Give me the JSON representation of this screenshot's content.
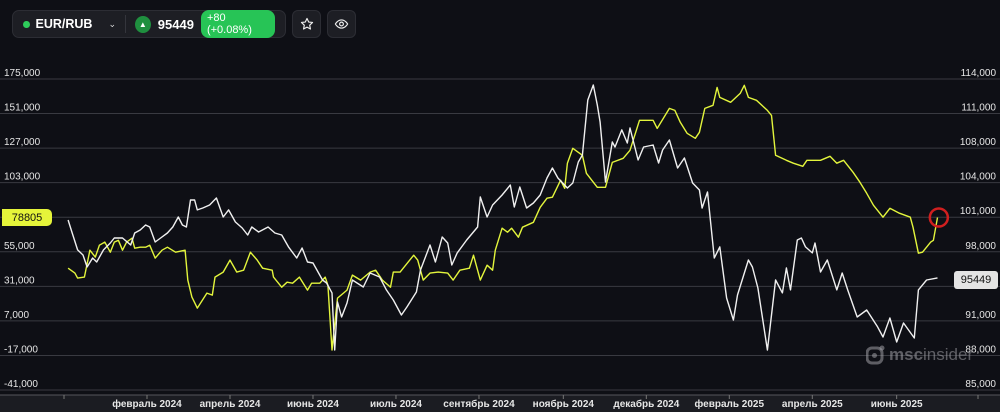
{
  "toolbar": {
    "pair": "EUR/RUB",
    "price": "95449",
    "change": "+80 (+0.08%)",
    "status_color": "#2ecc5b",
    "icons": [
      "chevron-down-icon",
      "arrow-up-icon",
      "star-icon",
      "eye-icon"
    ]
  },
  "watermark": {
    "brand_bold": "msc",
    "brand_light": "insider"
  },
  "chart_data": {
    "type": "line",
    "x_unit": "days from start",
    "x_ticks": [
      {
        "d": 61,
        "label": "февраль 2024"
      },
      {
        "d": 122,
        "label": "апрель 2024"
      },
      {
        "d": 183,
        "label": "июнь 2024"
      },
      {
        "d": 244,
        "label": "июль 2024"
      },
      {
        "d": 305,
        "label": "сентябрь 2024"
      },
      {
        "d": 367,
        "label": "ноябрь 2024"
      },
      {
        "d": 428,
        "label": "декабрь 2024"
      },
      {
        "d": 489,
        "label": "февраль 2025"
      },
      {
        "d": 550,
        "label": "апрель 2025"
      },
      {
        "d": 612,
        "label": "июнь 2025"
      }
    ],
    "left_axis": {
      "ylim": [
        -41000,
        175000
      ],
      "ticks": [
        "175,000",
        "151,000",
        "127,000",
        "103,000",
        "55,000",
        "31,000",
        "7,000",
        "-17,000",
        "-41,000"
      ],
      "tick_values": [
        175000,
        151000,
        127000,
        103000,
        55000,
        31000,
        7000,
        -17000,
        -41000
      ]
    },
    "right_axis": {
      "ylim": [
        85000,
        114000
      ],
      "ticks": [
        "114,000",
        "111,000",
        "108,000",
        "104,000",
        "101,000",
        "98,000",
        "91,000",
        "88,000",
        "85,000"
      ],
      "tick_values": [
        114000,
        111000,
        108000,
        104000,
        101000,
        98000,
        91000,
        88000,
        85000
      ]
    },
    "series": [
      {
        "name": "yellow",
        "axis": "left",
        "color": "#e3f53c",
        "last_label": "78805",
        "points": [
          [
            3,
            43600
          ],
          [
            8,
            40200
          ],
          [
            10,
            36700
          ],
          [
            15,
            37400
          ],
          [
            19,
            56100
          ],
          [
            23,
            51300
          ],
          [
            26,
            59600
          ],
          [
            30,
            61700
          ],
          [
            34,
            54700
          ],
          [
            37,
            61700
          ],
          [
            40,
            63000
          ],
          [
            43,
            56100
          ],
          [
            46,
            61700
          ],
          [
            50,
            64400
          ],
          [
            52,
            57500
          ],
          [
            56,
            58200
          ],
          [
            60,
            58200
          ],
          [
            63,
            59600
          ],
          [
            67,
            50600
          ],
          [
            72,
            56100
          ],
          [
            76,
            58200
          ],
          [
            82,
            54700
          ],
          [
            89,
            56100
          ],
          [
            91,
            35300
          ],
          [
            94,
            23500
          ],
          [
            98,
            15900
          ],
          [
            105,
            26300
          ],
          [
            109,
            24900
          ],
          [
            111,
            37400
          ],
          [
            117,
            40900
          ],
          [
            122,
            49200
          ],
          [
            127,
            40900
          ],
          [
            132,
            42200
          ],
          [
            137,
            54700
          ],
          [
            142,
            49200
          ],
          [
            146,
            43600
          ],
          [
            153,
            42200
          ],
          [
            154,
            37400
          ],
          [
            160,
            30400
          ],
          [
            164,
            33900
          ],
          [
            168,
            33200
          ],
          [
            173,
            37400
          ],
          [
            179,
            28400
          ],
          [
            182,
            33200
          ],
          [
            188,
            33200
          ],
          [
            192,
            37400
          ],
          [
            194,
            31800
          ],
          [
            197,
            -13200
          ],
          [
            201,
            22800
          ],
          [
            208,
            28400
          ],
          [
            212,
            38800
          ],
          [
            218,
            35300
          ],
          [
            225,
            40900
          ],
          [
            229,
            42200
          ],
          [
            234,
            35300
          ],
          [
            240,
            30400
          ],
          [
            242,
            40900
          ],
          [
            247,
            40900
          ],
          [
            257,
            52600
          ],
          [
            260,
            49200
          ],
          [
            264,
            35300
          ],
          [
            269,
            40200
          ],
          [
            275,
            40900
          ],
          [
            282,
            40200
          ],
          [
            286,
            35300
          ],
          [
            291,
            42200
          ],
          [
            298,
            43600
          ],
          [
            301,
            52600
          ],
          [
            304,
            42200
          ],
          [
            306,
            35300
          ],
          [
            311,
            45700
          ],
          [
            315,
            42200
          ],
          [
            317,
            56100
          ],
          [
            322,
            71400
          ],
          [
            326,
            68600
          ],
          [
            329,
            71400
          ],
          [
            334,
            65100
          ],
          [
            337,
            72100
          ],
          [
            345,
            75500
          ],
          [
            350,
            85900
          ],
          [
            355,
            92200
          ],
          [
            359,
            92900
          ],
          [
            365,
            104700
          ],
          [
            368,
            99100
          ],
          [
            370,
            116500
          ],
          [
            374,
            126900
          ],
          [
            381,
            122000
          ],
          [
            384,
            109500
          ],
          [
            392,
            99800
          ],
          [
            398,
            99800
          ],
          [
            403,
            117100
          ],
          [
            411,
            119900
          ],
          [
            416,
            125500
          ],
          [
            423,
            146300
          ],
          [
            433,
            146300
          ],
          [
            436,
            140700
          ],
          [
            445,
            154600
          ],
          [
            449,
            153200
          ],
          [
            453,
            144900
          ],
          [
            458,
            137300
          ],
          [
            464,
            133800
          ],
          [
            467,
            138000
          ],
          [
            471,
            154600
          ],
          [
            477,
            156700
          ],
          [
            480,
            169200
          ],
          [
            482,
            162200
          ],
          [
            490,
            158800
          ],
          [
            497,
            165000
          ],
          [
            500,
            170600
          ],
          [
            503,
            162200
          ],
          [
            509,
            160200
          ],
          [
            517,
            153200
          ],
          [
            520,
            149700
          ],
          [
            523,
            122000
          ],
          [
            531,
            118500
          ],
          [
            536,
            116500
          ],
          [
            543,
            114400
          ],
          [
            546,
            118500
          ],
          [
            556,
            118500
          ],
          [
            563,
            121300
          ],
          [
            568,
            116500
          ],
          [
            573,
            118500
          ],
          [
            580,
            110200
          ],
          [
            585,
            103300
          ],
          [
            590,
            95600
          ],
          [
            595,
            87300
          ],
          [
            602,
            79000
          ],
          [
            607,
            85200
          ],
          [
            614,
            81800
          ],
          [
            622,
            79000
          ],
          [
            624,
            72100
          ],
          [
            628,
            54000
          ],
          [
            631,
            54700
          ],
          [
            637,
            61700
          ],
          [
            639,
            63000
          ],
          [
            642,
            78805
          ]
        ]
      },
      {
        "name": "white",
        "axis": "right",
        "color": "#f0f0f0",
        "last_label": "95449",
        "points": [
          [
            3,
            100850
          ],
          [
            6,
            99640
          ],
          [
            10,
            98060
          ],
          [
            14,
            97590
          ],
          [
            17,
            96470
          ],
          [
            21,
            97310
          ],
          [
            24,
            96940
          ],
          [
            29,
            98060
          ],
          [
            34,
            98710
          ],
          [
            37,
            99170
          ],
          [
            43,
            99170
          ],
          [
            49,
            98520
          ],
          [
            52,
            99640
          ],
          [
            56,
            99920
          ],
          [
            60,
            100390
          ],
          [
            63,
            100200
          ],
          [
            67,
            98800
          ],
          [
            71,
            99170
          ],
          [
            76,
            99640
          ],
          [
            80,
            100200
          ],
          [
            84,
            101130
          ],
          [
            87,
            100390
          ],
          [
            90,
            100200
          ],
          [
            93,
            102720
          ],
          [
            96,
            102720
          ],
          [
            98,
            101790
          ],
          [
            102,
            101970
          ],
          [
            107,
            102250
          ],
          [
            112,
            102900
          ],
          [
            117,
            101130
          ],
          [
            121,
            101790
          ],
          [
            126,
            100670
          ],
          [
            131,
            100110
          ],
          [
            135,
            99450
          ],
          [
            138,
            100200
          ],
          [
            143,
            99730
          ],
          [
            150,
            100200
          ],
          [
            155,
            99640
          ],
          [
            160,
            99450
          ],
          [
            165,
            98340
          ],
          [
            171,
            97310
          ],
          [
            175,
            98240
          ],
          [
            179,
            96940
          ],
          [
            183,
            96840
          ],
          [
            190,
            95260
          ],
          [
            193,
            94980
          ],
          [
            197,
            94050
          ],
          [
            199,
            88730
          ],
          [
            201,
            93210
          ],
          [
            204,
            91810
          ],
          [
            208,
            93110
          ],
          [
            212,
            95260
          ],
          [
            220,
            94600
          ],
          [
            225,
            95910
          ],
          [
            232,
            95540
          ],
          [
            237,
            94330
          ],
          [
            242,
            93390
          ],
          [
            248,
            91990
          ],
          [
            252,
            92740
          ],
          [
            259,
            94140
          ],
          [
            262,
            96190
          ],
          [
            269,
            98520
          ],
          [
            273,
            96940
          ],
          [
            278,
            99270
          ],
          [
            282,
            98710
          ],
          [
            285,
            96660
          ],
          [
            289,
            97780
          ],
          [
            296,
            98990
          ],
          [
            304,
            100200
          ],
          [
            306,
            103000
          ],
          [
            311,
            101130
          ],
          [
            315,
            102250
          ],
          [
            322,
            103180
          ],
          [
            328,
            104120
          ],
          [
            331,
            102060
          ],
          [
            335,
            103930
          ],
          [
            340,
            101970
          ],
          [
            345,
            102440
          ],
          [
            350,
            103180
          ],
          [
            355,
            104770
          ],
          [
            359,
            105700
          ],
          [
            363,
            104770
          ],
          [
            370,
            103840
          ],
          [
            374,
            104300
          ],
          [
            378,
            106260
          ],
          [
            381,
            106910
          ],
          [
            385,
            112040
          ],
          [
            389,
            113440
          ],
          [
            392,
            111580
          ],
          [
            394,
            109990
          ],
          [
            398,
            104400
          ],
          [
            403,
            108130
          ],
          [
            405,
            107660
          ],
          [
            410,
            109250
          ],
          [
            414,
            108030
          ],
          [
            416,
            109430
          ],
          [
            422,
            106450
          ],
          [
            426,
            107660
          ],
          [
            433,
            107850
          ],
          [
            437,
            106170
          ],
          [
            440,
            107380
          ],
          [
            445,
            108310
          ],
          [
            451,
            105700
          ],
          [
            456,
            106630
          ],
          [
            462,
            104300
          ],
          [
            467,
            103650
          ],
          [
            469,
            101970
          ],
          [
            473,
            103460
          ],
          [
            478,
            97310
          ],
          [
            482,
            98340
          ],
          [
            487,
            93580
          ],
          [
            492,
            91530
          ],
          [
            495,
            93860
          ],
          [
            503,
            97120
          ],
          [
            506,
            96470
          ],
          [
            510,
            94510
          ],
          [
            517,
            88730
          ],
          [
            523,
            95260
          ],
          [
            528,
            94050
          ],
          [
            531,
            96380
          ],
          [
            534,
            94330
          ],
          [
            539,
            98990
          ],
          [
            542,
            99170
          ],
          [
            545,
            98340
          ],
          [
            550,
            97780
          ],
          [
            552,
            98710
          ],
          [
            556,
            96000
          ],
          [
            561,
            97120
          ],
          [
            568,
            94330
          ],
          [
            572,
            95910
          ],
          [
            576,
            94330
          ],
          [
            583,
            91810
          ],
          [
            590,
            92460
          ],
          [
            598,
            90880
          ],
          [
            602,
            89940
          ],
          [
            607,
            91710
          ],
          [
            612,
            89480
          ],
          [
            617,
            91250
          ],
          [
            625,
            89850
          ],
          [
            628,
            94330
          ],
          [
            634,
            95260
          ],
          [
            642,
            95449
          ]
        ]
      }
    ],
    "marker": {
      "type": "circle",
      "color": "#d01f1f",
      "series": "yellow",
      "d": 643
    }
  }
}
